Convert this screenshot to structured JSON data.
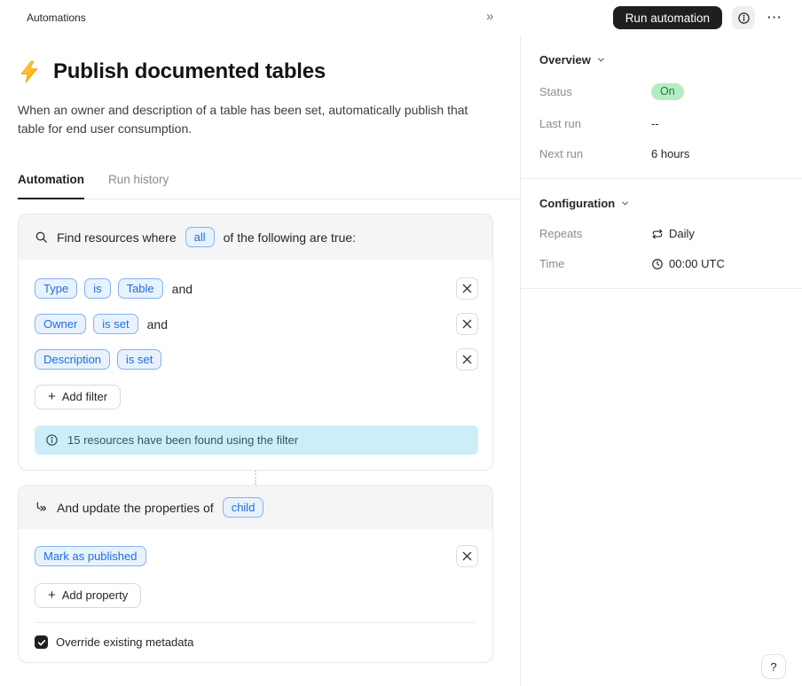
{
  "colors": {
    "accent_blue": "#1d6fe0",
    "chip_bg": "#e8f2fd",
    "chip_border": "#83b3f3",
    "banner_bg": "#cdeef8",
    "banner_text": "#2e5866",
    "status_on_bg": "#b5ecc4",
    "status_on_text": "#257a3e",
    "run_button_bg": "#1f1f1f",
    "bolt_yellow": "#ffc02e"
  },
  "icons": {
    "collapse": "»",
    "more": "⋯",
    "plus": "+"
  },
  "topbar": {
    "breadcrumb": "Automations",
    "run_button_label": "Run automation"
  },
  "header": {
    "title": "Publish documented tables",
    "description": "When an owner and description of a table has been set, automatically publish that table for end user consumption."
  },
  "tabs": {
    "automation": "Automation",
    "run_history": "Run history"
  },
  "filter_card": {
    "prefix": "Find resources where",
    "match_chip": "all",
    "suffix": "of the following are true:",
    "rows": [
      {
        "chips": [
          "Type",
          "is",
          "Table"
        ],
        "conjunction": "and"
      },
      {
        "chips": [
          "Owner",
          "is set"
        ],
        "conjunction": "and"
      },
      {
        "chips": [
          "Description",
          "is set"
        ],
        "conjunction": ""
      }
    ],
    "add_filter_label": "Add filter",
    "banner_text": "15 resources have been found using the filter"
  },
  "update_card": {
    "prefix": "And update the properties of",
    "target_chip": "child",
    "property_chip": "Mark as published",
    "add_property_label": "Add property",
    "checkbox_label": "Override existing metadata",
    "checkbox_checked": true
  },
  "sidebar": {
    "overview": {
      "title": "Overview",
      "status_label": "Status",
      "status_value": "On",
      "last_run_label": "Last run",
      "last_run_value": "--",
      "next_run_label": "Next run",
      "next_run_value": "6 hours"
    },
    "configuration": {
      "title": "Configuration",
      "repeats_label": "Repeats",
      "repeats_value": "Daily",
      "time_label": "Time",
      "time_value": "00:00 UTC"
    },
    "help_label": "?"
  }
}
